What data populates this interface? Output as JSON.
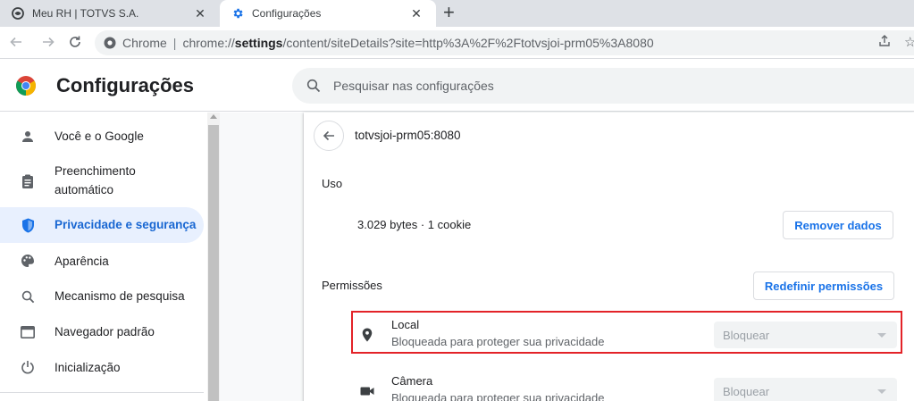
{
  "tabs": [
    {
      "title": "Meu RH | TOTVS S.A.",
      "icon": "totvs-logo-icon"
    },
    {
      "title": "Configurações",
      "icon": "gear-icon",
      "active": true
    }
  ],
  "toolbar": {
    "chip_label": "Chrome",
    "url_prefix": "chrome://",
    "url_host": "settings",
    "url_rest": "/content/siteDetails?site=http%3A%2F%2Ftotvsjoi-prm05%3A8080"
  },
  "header": {
    "title": "Configurações",
    "search_placeholder": "Pesquisar nas configurações"
  },
  "sidebar": {
    "items": [
      {
        "label": "Você e o Google",
        "icon": "person-icon"
      },
      {
        "label": "Preenchimento",
        "label2": "automático",
        "icon": "clipboard-icon"
      },
      {
        "label": "Privacidade e segurança",
        "icon": "shield-icon",
        "active": true
      },
      {
        "label": "Aparência",
        "icon": "palette-icon"
      },
      {
        "label": "Mecanismo de pesquisa",
        "icon": "search-icon"
      },
      {
        "label": "Navegador padrão",
        "icon": "browser-icon"
      },
      {
        "label": "Inicialização",
        "icon": "power-icon"
      }
    ]
  },
  "site": {
    "name": "totvsjoi-prm05:8080",
    "usage_heading": "Uso",
    "usage_text": "3.029 bytes · 1 cookie",
    "remove_button": "Remover dados",
    "permissions_heading": "Permissões",
    "reset_button": "Redefinir permissões",
    "permissions": [
      {
        "title": "Local",
        "subtitle": "Bloqueada para proteger sua privacidade",
        "value": "Bloquear",
        "icon": "location-pin-icon"
      },
      {
        "title": "Câmera",
        "subtitle": "Bloqueada para proteger sua privacidade",
        "value": "Bloquear",
        "icon": "camera-icon"
      }
    ]
  },
  "colors": {
    "accent": "#1a73e8",
    "active_bg": "#e8f0fe",
    "highlight_border": "#e32328"
  }
}
